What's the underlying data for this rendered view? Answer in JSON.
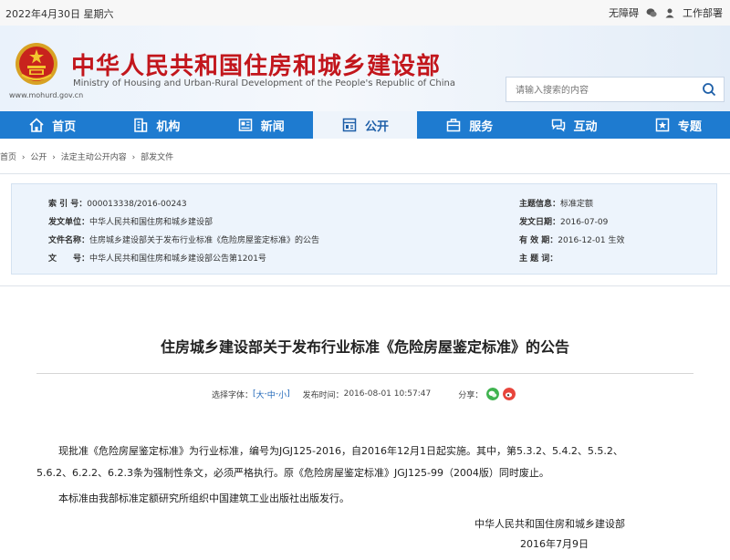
{
  "topbar": {
    "date": "2022年4月30日  星期六",
    "accessibility": "无障碍",
    "work_portal": "工作部署"
  },
  "header": {
    "url": "www.mohurd.gov.cn",
    "cn_title": "中华人民共和国住房和城乡建设部",
    "en_title": "Ministry of Housing and Urban-Rural Development of the People's Republic of China",
    "search_placeholder": "请输入搜索的内容"
  },
  "nav": [
    {
      "label": "首页",
      "icon": "home-icon"
    },
    {
      "label": "机构",
      "icon": "building-icon"
    },
    {
      "label": "新闻",
      "icon": "news-icon"
    },
    {
      "label": "公开",
      "icon": "open-doc-icon"
    },
    {
      "label": "服务",
      "icon": "service-icon"
    },
    {
      "label": "互动",
      "icon": "chat-icon"
    },
    {
      "label": "专题",
      "icon": "topic-icon"
    }
  ],
  "breadcrumb": [
    "首页",
    "›",
    "公开",
    "›",
    "法定主动公开内容",
    "›",
    "部发文件"
  ],
  "info": {
    "index_label": "索 引 号：",
    "index_value": "000013338/2016-00243",
    "issuer_label": "发文单位：",
    "issuer_value": "中华人民共和国住房和城乡建设部",
    "docname_label": "文件名称：",
    "docname_value": "住房城乡建设部关于发布行业标准《危险房屋鉴定标准》的公告",
    "docno_label": "文　　号：",
    "docno_value": "中华人民共和国住房和城乡建设部公告第1201号",
    "topic_label": "主题信息：",
    "topic_value": "标准定额",
    "date_label": "发文日期：",
    "date_value": "2016-07-09",
    "valid_label": "有 效 期：",
    "valid_value": "2016-12-01 生效",
    "subject_label": "主 题 词：",
    "subject_value": ""
  },
  "article": {
    "title": "住房城乡建设部关于发布行业标准《危险房屋鉴定标准》的公告",
    "font_label": "选择字体：",
    "font_open": "[ ",
    "font_large": "大",
    "font_sep": " - ",
    "font_mid": "中",
    "font_sep2": " - ",
    "font_small": "小",
    "font_close": " ]",
    "time_label": "发布时间：",
    "time_value": "2016-08-01 10:57:47",
    "share_label": "分享：",
    "para1_line1": "现批准《危险房屋鉴定标准》为行业标准，编号为JGJ125-2016，自2016年12月1日起实施。其中，第5.3.2、5.4.2、5.5.2、",
    "para1_line2": "5.6.2、6.2.2、6.2.3条为强制性条文，必须严格执行。原《危险房屋鉴定标准》JGJ125-99（2004版）同时废止。",
    "para2": "本标准由我部标准定额研究所组织中国建筑工业出版社出版发行。",
    "sig_org": "中华人民共和国住房和城乡建设部",
    "sig_date": "2016年7月9日"
  },
  "colors": {
    "nav_blue": "#1e7bd0",
    "title_red": "#c2161c",
    "info_bg": "#edf4fc"
  }
}
